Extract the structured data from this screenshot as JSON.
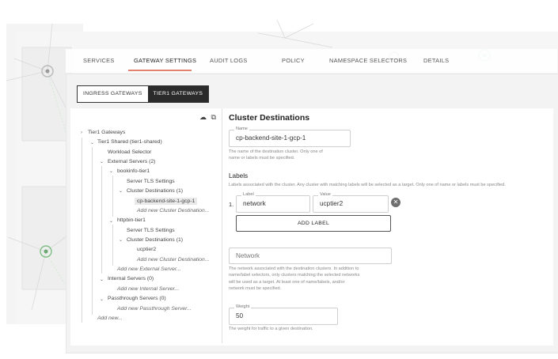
{
  "colors": {
    "accent": "#e0826e",
    "toggle_active": "#2b2b2b",
    "background_graph": "#f4f4f4"
  },
  "tabs": [
    {
      "label": "SERVICES"
    },
    {
      "label": "GATEWAY SETTINGS",
      "active": true
    },
    {
      "label": "AUDIT LOGS"
    },
    {
      "label": "POLICY"
    },
    {
      "label": "NAMESPACE SELECTORS"
    },
    {
      "label": "DETAILS"
    }
  ],
  "gateway_toggle": {
    "ingress": "INGRESS GATEWAYS",
    "tier1": "TIER1 GATEWAYS",
    "selected": "TIER1 GATEWAYS"
  },
  "tree_tools": {
    "upload_icon": "cloud-upload-icon",
    "copy_icon": "copy-icon"
  },
  "tree": {
    "root": "Tier1 Gateways",
    "shared": "Tier1 Shared (tier1-shared)",
    "workload_selector": "Workload Selector",
    "external_servers": "External Servers (2)",
    "bookinfo": "bookinfo-tier1",
    "bookinfo_tls": "Server TLS Settings",
    "bookinfo_cd": "Cluster Destinations (1)",
    "bookinfo_cd_item": "cp-backend-site-1-gcp-1",
    "bookinfo_cd_add": "Add new Cluster Destination...",
    "httpbin": "httpbin-tier1",
    "httpbin_tls": "Server TLS Settings",
    "httpbin_cd": "Cluster Destinations (1)",
    "httpbin_cd_item": "ucptier2",
    "httpbin_cd_add": "Add new Cluster Destination...",
    "add_external": "Add new External Server...",
    "internal_servers": "Internal Servers (0)",
    "add_internal": "Add new Internal Server...",
    "passthrough_servers": "Passthrough Servers (0)",
    "add_passthrough": "Add new Passthrough Server...",
    "add_new": "Add new..."
  },
  "form": {
    "title": "Cluster Destinations",
    "name": {
      "label": "Name",
      "value": "cp-backend-site-1-gcp-1",
      "help1": "The name of the destination cluster. Only one of",
      "help2": "name or labels must be specified."
    },
    "labels": {
      "heading": "Labels",
      "help": "Labels associated with the cluster. Any cluster with matching labels will be selected as a target. Only one of name or labels must be specified.",
      "rows": [
        {
          "index": "1.",
          "label_caption": "Label",
          "label": "network",
          "value_caption": "Value",
          "value": "ucptier2"
        }
      ],
      "add_button": "ADD LABEL"
    },
    "network": {
      "placeholder": "Network",
      "help1": "The network associated with the destination clusters. In addition to",
      "help2": "name/label selectors, only clusters matching the selected networks",
      "help3": "will be used as a target. At least one of name/labels, and/or",
      "help4": "network must be specified."
    },
    "weight": {
      "label": "Weight",
      "value": "50",
      "help": "The weight for traffic to a given destination."
    }
  }
}
